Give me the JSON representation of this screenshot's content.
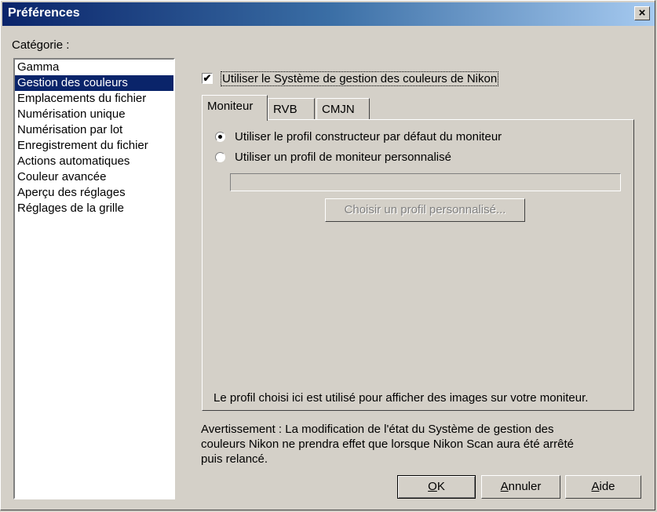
{
  "window": {
    "title": "Préférences",
    "close_glyph": "×"
  },
  "category": {
    "label": "Catégorie :",
    "items": [
      "Gamma",
      "Gestion des couleurs",
      "Emplacements du fichier",
      "Numérisation unique",
      "Numérisation par lot",
      "Enregistrement du fichier",
      "Actions automatiques",
      "Couleur avancée",
      "Aperçu des réglages",
      "Réglages de la grille"
    ],
    "selected_index": 1
  },
  "cms_checkbox": {
    "label": "Utiliser le Système de gestion des couleurs de Nikon",
    "checked": true,
    "check_glyph": "✔"
  },
  "tabs": [
    "Moniteur",
    "RVB",
    "CMJN"
  ],
  "monitor": {
    "radio1_label": "Utiliser le profil constructeur par défaut du moniteur",
    "radio2_label": "Utiliser un profil de moniteur personnalisé",
    "profile_path": "",
    "choose_button": "Choisir un profil personnalisé...",
    "note": "Le profil choisi ici est utilisé pour afficher des images sur votre moniteur."
  },
  "warning": {
    "line1": "Avertissement : La modification de l'état du Système de gestion des",
    "line2": "couleurs Nikon ne prendra effet que lorsque Nikon Scan aura été arrêté",
    "line3": "puis relancé."
  },
  "buttons": {
    "ok_u": "O",
    "ok_rest": "K",
    "cancel_u": "A",
    "cancel_rest": "nnuler",
    "help_u": "A",
    "help_rest": "ide"
  }
}
